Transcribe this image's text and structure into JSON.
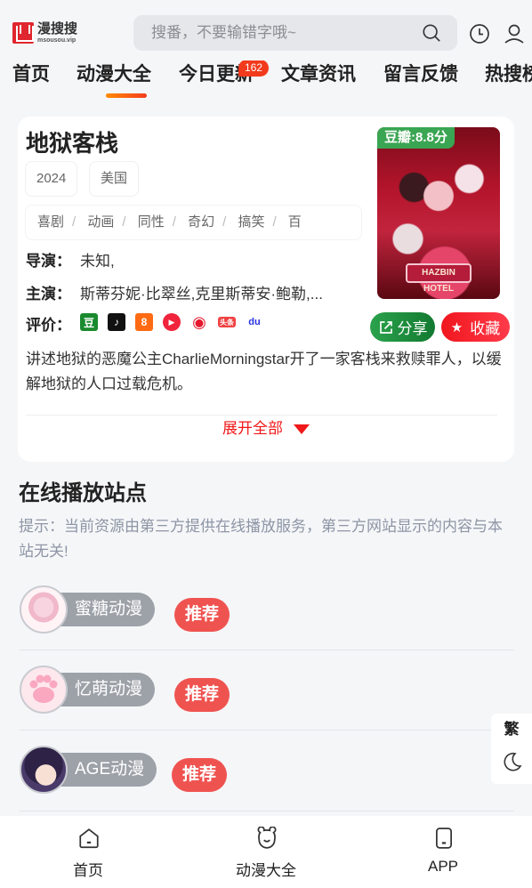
{
  "header": {
    "logo_title": "漫搜搜",
    "logo_sub": "msousou.vip",
    "search_placeholder": "搜番，不要输错字哦~",
    "search_value": ""
  },
  "nav": {
    "items": [
      {
        "label": "首页"
      },
      {
        "label": "动漫大全",
        "active": true
      },
      {
        "label": "今日更新",
        "badge": "162"
      },
      {
        "label": "文章资讯"
      },
      {
        "label": "留言反馈"
      },
      {
        "label": "热搜榜"
      }
    ]
  },
  "detail": {
    "title": "地狱客栈",
    "year": "2024",
    "region": "美国",
    "genres": [
      "喜剧",
      "动画",
      "同性",
      "奇幻",
      "搞笑",
      "百"
    ],
    "director_label": "导演：",
    "director": "未知,",
    "cast_label": "主演：",
    "cast": "斯蒂芬妮·比翠丝,克里斯蒂安·鲍勒,...",
    "rating_label": "评价：",
    "rating_sources": [
      {
        "name": "douban-icon",
        "glyph": "豆",
        "color": "#1a8a2e"
      },
      {
        "name": "douyin-icon",
        "glyph": "♪",
        "color": "#111111"
      },
      {
        "name": "kuaishou-icon",
        "glyph": "8",
        "color": "#ff6a13"
      },
      {
        "name": "video-play-icon",
        "glyph": "▶",
        "color": "#f0243c"
      },
      {
        "name": "weibo-icon",
        "glyph": "◉",
        "color": "#e6162d"
      },
      {
        "name": "toutiao-icon",
        "glyph": "头条",
        "color": "#f04142"
      },
      {
        "name": "baidu-icon",
        "glyph": "du",
        "color": "#2932e1"
      }
    ],
    "score": "豆瓣:8.8分",
    "poster_title": "HAZBIN HOTEL",
    "share_label": "分享",
    "favorite_label": "收藏",
    "description": "讲述地狱的恶魔公主CharlieMorningstar开了一家客栈来救赎罪人，以缓解地狱的人口过载危机。",
    "expand_label": "展开全部"
  },
  "sites": {
    "title": "在线播放站点",
    "tip": "提示：当前资源由第三方提供在线播放服务，第三方网站显示的内容与本站无关!",
    "items": [
      {
        "name": "蜜糖动漫",
        "tag": "推荐"
      },
      {
        "name": "忆萌动漫",
        "tag": "推荐"
      },
      {
        "name": "AGE动漫",
        "tag": "推荐"
      }
    ]
  },
  "float_panel": {
    "traditional_label": "繁"
  },
  "bottom_bar": {
    "tabs": [
      {
        "label": "首页",
        "icon": "home-icon"
      },
      {
        "label": "动漫大全",
        "icon": "bear-icon"
      },
      {
        "label": "APP",
        "icon": "phone-icon"
      }
    ]
  }
}
